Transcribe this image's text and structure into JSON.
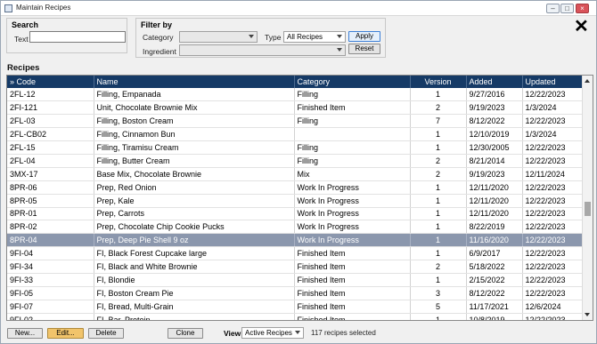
{
  "window": {
    "title": "Maintain Recipes"
  },
  "search": {
    "title": "Search",
    "text_label": "Text",
    "text_value": ""
  },
  "filter": {
    "title": "Filter by",
    "category_label": "Category",
    "category_value": "",
    "type_label": "Type",
    "type_value": "All Recipes",
    "ingredient_label": "Ingredient",
    "ingredient_value": "",
    "apply_label": "Apply",
    "reset_label": "Reset"
  },
  "recipes": {
    "title": "Recipes",
    "columns": [
      "» Code",
      "Name",
      "Category",
      "Version",
      "Added",
      "Updated"
    ],
    "rows": [
      [
        "2FL-12",
        "Filling, Empanada",
        "Filling",
        "1",
        "9/27/2016",
        "12/22/2023"
      ],
      [
        "2FI-121",
        "Unit, Chocolate Brownie Mix",
        "Finished Item",
        "2",
        "9/19/2023",
        "1/3/2024"
      ],
      [
        "2FL-03",
        "Filling, Boston Cream",
        "Filling",
        "7",
        "8/12/2022",
        "12/22/2023"
      ],
      [
        "2FL-CB02",
        "Filling, Cinnamon Bun",
        "",
        "1",
        "12/10/2019",
        "1/3/2024"
      ],
      [
        "2FL-15",
        "Filling, Tiramisu Cream",
        "Filling",
        "1",
        "12/30/2005",
        "12/22/2023"
      ],
      [
        "2FL-04",
        "Filling, Butter Cream",
        "Filling",
        "2",
        "8/21/2014",
        "12/22/2023"
      ],
      [
        "3MX-17",
        "Base Mix, Chocolate Brownie",
        "Mix",
        "2",
        "9/19/2023",
        "12/11/2024"
      ],
      [
        "8PR-06",
        "Prep, Red Onion",
        "Work In Progress",
        "1",
        "12/11/2020",
        "12/22/2023"
      ],
      [
        "8PR-05",
        "Prep, Kale",
        "Work In Progress",
        "1",
        "12/11/2020",
        "12/22/2023"
      ],
      [
        "8PR-01",
        "Prep, Carrots",
        "Work In Progress",
        "1",
        "12/11/2020",
        "12/22/2023"
      ],
      [
        "8PR-02",
        "Prep, Chocolate Chip Cookie Pucks",
        "Work In Progress",
        "1",
        "8/22/2019",
        "12/22/2023"
      ],
      [
        "8PR-04",
        "Prep, Deep Pie Shell 9 oz",
        "Work In Progress",
        "1",
        "11/16/2020",
        "12/22/2023"
      ],
      [
        "9FI-04",
        "FI, Black Forest Cupcake large",
        "Finished Item",
        "1",
        "6/9/2017",
        "12/22/2023"
      ],
      [
        "9FI-34",
        "FI, Black and White Brownie",
        "Finished Item",
        "2",
        "5/18/2022",
        "12/22/2023"
      ],
      [
        "9FI-33",
        "FI, Blondie",
        "Finished Item",
        "1",
        "2/15/2022",
        "12/22/2023"
      ],
      [
        "9FI-05",
        "FI, Boston Cream Pie",
        "Finished Item",
        "3",
        "8/12/2022",
        "12/22/2023"
      ],
      [
        "9FI-07",
        "FI, Bread, Multi-Grain",
        "Finished Item",
        "5",
        "11/17/2021",
        "12/6/2024"
      ],
      [
        "9FI-02",
        "FI, Bar, Protein",
        "Finished Item",
        "1",
        "10/8/2019",
        "12/22/2023"
      ]
    ],
    "selected_index": 11
  },
  "footer": {
    "new_label": "New...",
    "edit_label": "Edit...",
    "delete_label": "Delete",
    "clone_label": "Clone",
    "view_label": "View",
    "view_value": "Active Recipes",
    "status_text": "117 recipes selected"
  },
  "colors": {
    "header_bg": "#153a66",
    "selected_row": "#8b97ad",
    "edit_button": "#f1c46b"
  }
}
